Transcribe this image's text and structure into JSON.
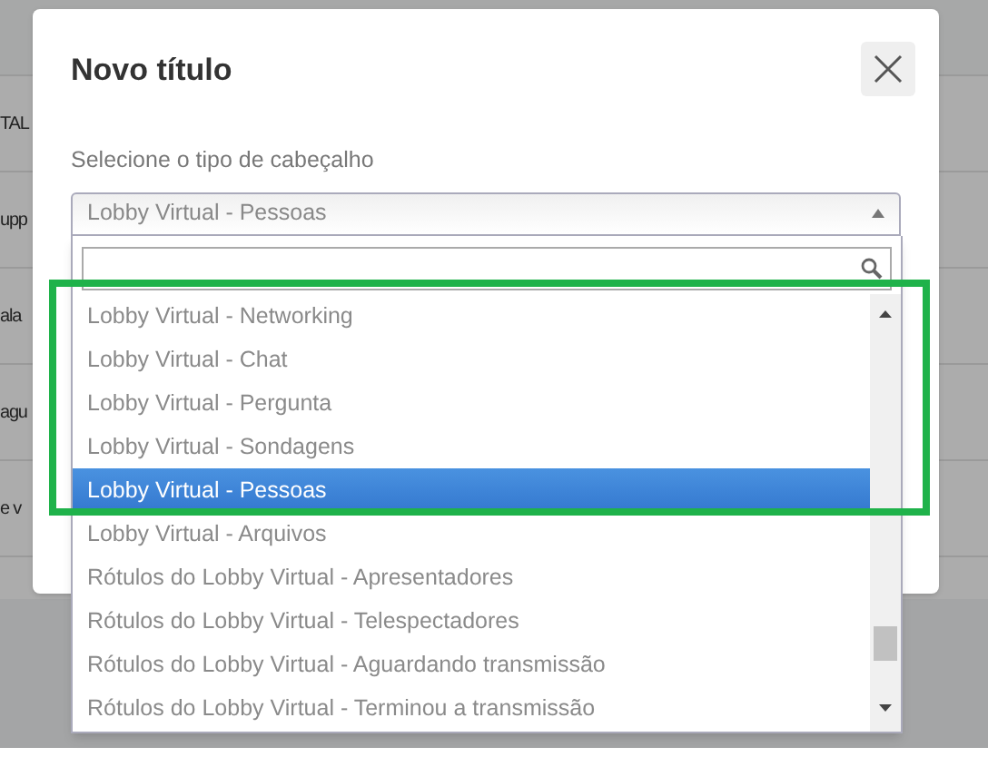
{
  "background_rows": [
    "TAL",
    "upp",
    "ala",
    "agu",
    "e v"
  ],
  "dialog": {
    "title": "Novo título",
    "field_label": "Selecione o tipo de cabeçalho",
    "select_value": "Lobby Virtual - Pessoas",
    "expanded": true
  },
  "options": [
    {
      "label": "Lobby Virtual - Networking",
      "selected": false
    },
    {
      "label": "Lobby Virtual - Chat",
      "selected": false
    },
    {
      "label": "Lobby Virtual - Pergunta",
      "selected": false
    },
    {
      "label": "Lobby Virtual - Sondagens",
      "selected": false
    },
    {
      "label": "Lobby Virtual - Pessoas",
      "selected": true
    },
    {
      "label": "Lobby Virtual - Arquivos",
      "selected": false
    },
    {
      "label": "Rótulos do Lobby Virtual - Apresentadores",
      "selected": false
    },
    {
      "label": "Rótulos do Lobby Virtual - Telespectadores",
      "selected": false
    },
    {
      "label": "Rótulos do Lobby Virtual - Aguardando transmissão",
      "selected": false
    },
    {
      "label": "Rótulos do Lobby Virtual - Terminou a transmissão",
      "selected": false
    }
  ]
}
